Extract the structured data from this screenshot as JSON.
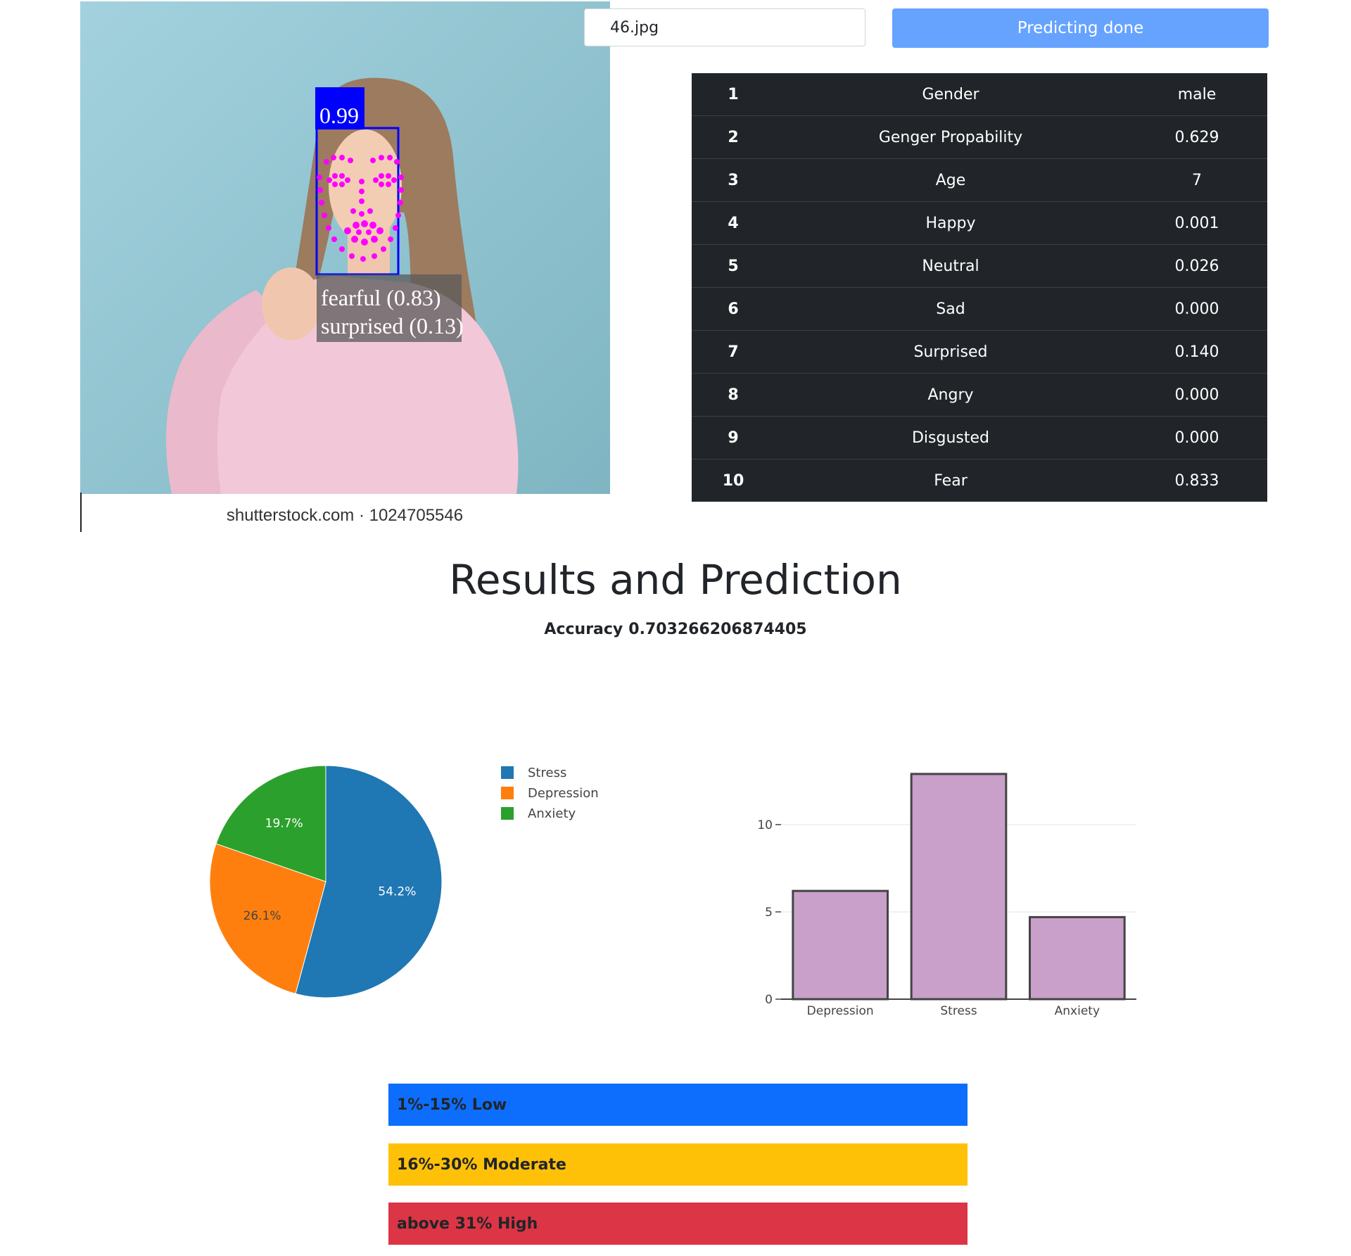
{
  "upload": {
    "file_value": "46.jpg",
    "button_label": "Predicting done"
  },
  "photo": {
    "face_score": "0.99",
    "emotion_line_1": "fearful (0.83)",
    "emotion_line_2": "surprised (0.13)",
    "watermark": "shutterstock.com · 1024705546"
  },
  "results_table": [
    {
      "index": "1",
      "label": "Gender",
      "value": "male"
    },
    {
      "index": "2",
      "label": "Genger Propability",
      "value": "0.629"
    },
    {
      "index": "3",
      "label": "Age",
      "value": "7"
    },
    {
      "index": "4",
      "label": "Happy",
      "value": "0.001"
    },
    {
      "index": "5",
      "label": "Neutral",
      "value": "0.026"
    },
    {
      "index": "6",
      "label": "Sad",
      "value": "0.000"
    },
    {
      "index": "7",
      "label": "Surprised",
      "value": "0.140"
    },
    {
      "index": "8",
      "label": "Angry",
      "value": "0.000"
    },
    {
      "index": "9",
      "label": "Disgusted",
      "value": "0.000"
    },
    {
      "index": "10",
      "label": "Fear",
      "value": "0.833"
    }
  ],
  "results": {
    "heading": "Results and Prediction",
    "accuracy_label": "Accuracy",
    "accuracy_value": "0.703266206874405"
  },
  "chart_data": [
    {
      "type": "pie",
      "slices": [
        {
          "label": "Stress",
          "percent": 54.2,
          "value_label": "54.2%",
          "color": "#1f77b4"
        },
        {
          "label": "Depression",
          "percent": 26.1,
          "value_label": "26.1%",
          "color": "#ff7f0e"
        },
        {
          "label": "Anxiety",
          "percent": 19.7,
          "value_label": "19.7%",
          "color": "#2ca02c"
        }
      ],
      "legend": [
        "Stress",
        "Depression",
        "Anxiety"
      ],
      "legend_position": "right"
    },
    {
      "type": "bar",
      "categories": [
        "Depression",
        "Stress",
        "Anxiety"
      ],
      "values": [
        6.2,
        12.9,
        4.7
      ],
      "yticks": [
        "0",
        "5",
        "10"
      ],
      "ylim": [
        0,
        13.3
      ],
      "bar_color": "#c9a0c9",
      "bar_edge_color": "#444444",
      "grid": true
    }
  ],
  "levels": [
    {
      "label": "1%-15% Low",
      "color": "#0d6efd"
    },
    {
      "label": "16%-30% Moderate",
      "color": "#ffc107"
    },
    {
      "label": "above 31% High",
      "color": "#dc3545"
    }
  ]
}
